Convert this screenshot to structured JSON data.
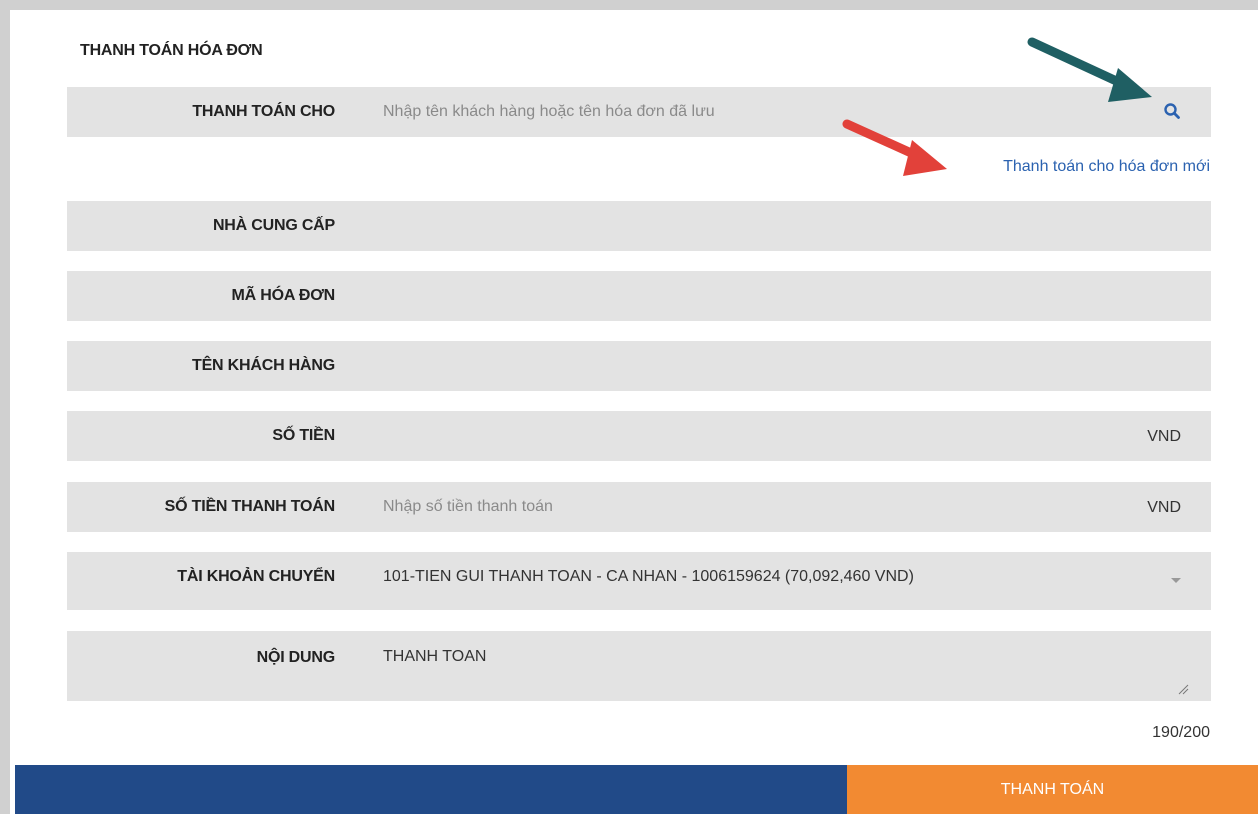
{
  "form": {
    "title": "THANH TOÁN HÓA ĐƠN",
    "pay_to": {
      "label": "THANH TOÁN CHO",
      "placeholder": "Nhập tên khách hàng hoặc tên hóa đơn đã lưu"
    },
    "new_bill_link": "Thanh toán cho hóa đơn mới",
    "provider": {
      "label": "NHÀ CUNG CẤP",
      "value": ""
    },
    "bill_code": {
      "label": "MÃ HÓA ĐƠN",
      "value": ""
    },
    "customer_name": {
      "label": "TÊN KHÁCH HÀNG",
      "value": ""
    },
    "amount": {
      "label": "SỐ TIỀN",
      "value": "",
      "unit": "VND"
    },
    "payment_amount": {
      "label": "SỐ TIỀN THANH TOÁN",
      "placeholder": "Nhập số tiền thanh toán",
      "unit": "VND"
    },
    "source_account": {
      "label": "TÀI KHOẢN CHUYỂN",
      "selected": "101-TIEN GUI THANH TOAN - CA NHAN - 1006159624 (70,092,460 VND)"
    },
    "content": {
      "label": "NỘI DUNG",
      "value": "THANH TOAN"
    },
    "char_counter": "190/200"
  },
  "footer": {
    "submit_label": "THANH TOÁN"
  },
  "annotations": {
    "arrow_teal_color": "#1f5f63",
    "arrow_red_color": "#e2413a"
  },
  "icons": {
    "search": "search-icon",
    "dropdown": "chevron-down-icon",
    "resize": "resize-handle-icon"
  }
}
